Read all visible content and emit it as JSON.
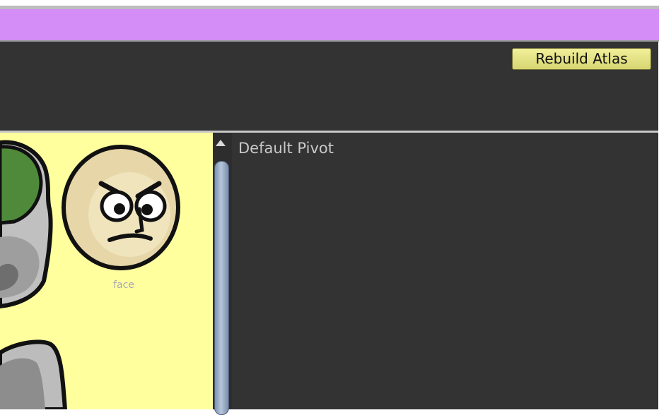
{
  "toolbar": {
    "rebuild_label": "Rebuild Atlas"
  },
  "sprites": [
    {
      "name": "face",
      "icon": "angry-face-icon"
    }
  ],
  "inspector": {
    "pivot_label": "Default Pivot"
  },
  "colors": {
    "header_purple": "#d48cf6",
    "panel_dark": "#333333",
    "sprite_bg": "#ffff9e",
    "button_yellow": "#e4e283"
  }
}
